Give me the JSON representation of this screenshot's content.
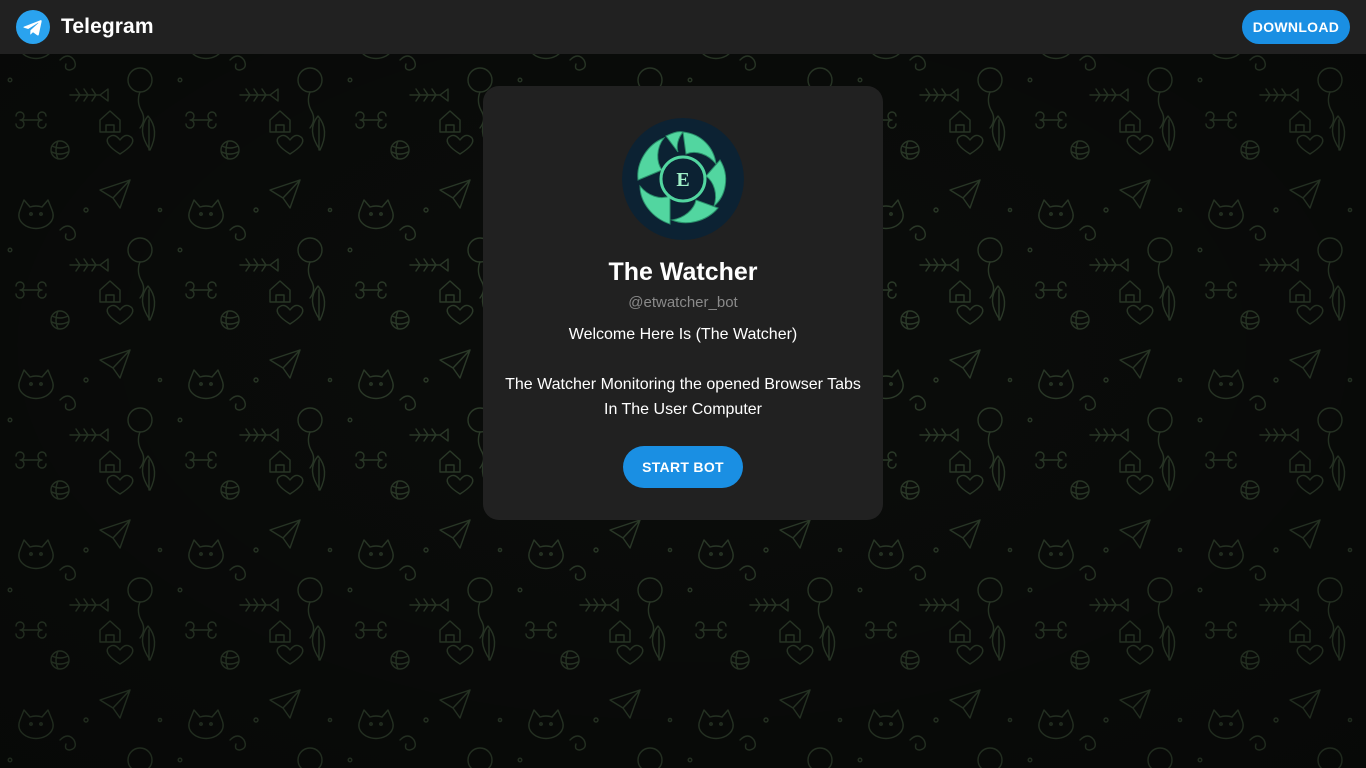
{
  "header": {
    "brand_name": "Telegram",
    "logo_icon": "telegram-plane-icon",
    "download_label": "DOWNLOAD"
  },
  "bot": {
    "avatar_letter": "E",
    "name": "The Watcher",
    "username": "@etwatcher_bot",
    "description_line1": "Welcome Here Is (The Watcher)",
    "description_line2": "The Watcher Monitoring the opened Browser Tabs In The User Computer",
    "start_label": "START BOT"
  },
  "colors": {
    "accent": "#1a8fe3",
    "topbar": "#212121",
    "card": "#212121",
    "background": "#0b0d0b",
    "pattern": "#2f3f2c",
    "avatar_green": "#52d6a0",
    "avatar_navy": "#0c2233"
  }
}
